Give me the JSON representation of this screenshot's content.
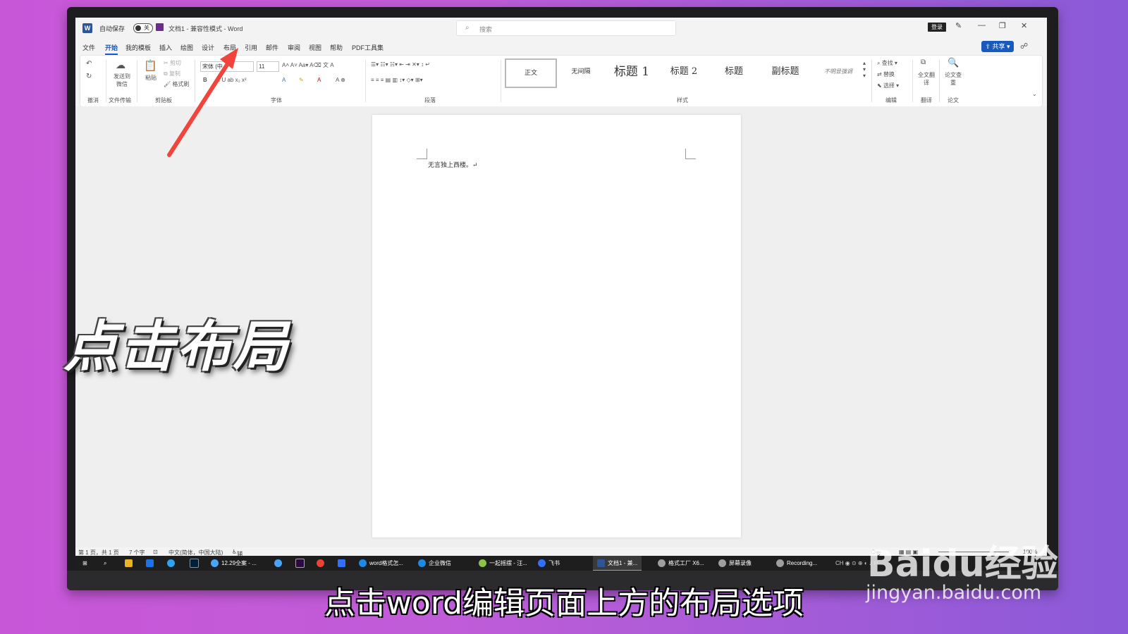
{
  "titlebar": {
    "autosave_label": "自动保存",
    "autosave_state": "关",
    "doc_title": "文档1 - 兼容性模式 - Word",
    "search_placeholder": "搜索",
    "login": "登录"
  },
  "tabs": [
    "文件",
    "开始",
    "我的模板",
    "插入",
    "绘图",
    "设计",
    "布局",
    "引用",
    "邮件",
    "审阅",
    "视图",
    "帮助",
    "PDF工具集"
  ],
  "active_tab": "开始",
  "share_label": "共享",
  "ribbon": {
    "groups": [
      "撤消",
      "文件传输",
      "剪贴板",
      "字体",
      "段落",
      "样式",
      "编辑",
      "翻译",
      "论文"
    ],
    "send_wechat": "发送到微信",
    "paste": "粘贴",
    "cut": "剪切",
    "copy": "复制",
    "format_painter": "格式刷",
    "font_name": "宋体 (中",
    "font_size": "11",
    "styles": [
      "正文",
      "无间隔",
      "标题 1",
      "标题 2",
      "标题",
      "副标题",
      "不明显强调"
    ],
    "find": "查找",
    "replace": "替换",
    "select": "选择",
    "translate": "全文翻译",
    "paper_check": "论文查重"
  },
  "document": {
    "text": "无言独上西楼。↵"
  },
  "statusbar": {
    "page": "第 1 页，共 1 页",
    "words": "7 个字",
    "language": "中文(简体，中国大陆)",
    "accessibility": "辅助功能: 一切就绪",
    "focus": "专注",
    "zoom": "100%"
  },
  "taskbar": {
    "items": [
      "12.29全案 - ...",
      "word格式怎...",
      "企业微信",
      "一起摇摆 - 汪...",
      "飞书",
      "文档1 - 兼...",
      "格式工厂 X6...",
      "屏幕录像",
      "Recording..."
    ]
  },
  "overlay": {
    "caption": "点击布局",
    "subtitle": "点击word编辑页面上方的布局选项"
  },
  "watermark": {
    "logo": "Baidu经验",
    "url": "jingyan.baidu.com"
  },
  "colors": {
    "accent": "#185abd",
    "arrow": "#f0443c",
    "background_left": "#c857d8",
    "background_right": "#8a5ad8"
  }
}
